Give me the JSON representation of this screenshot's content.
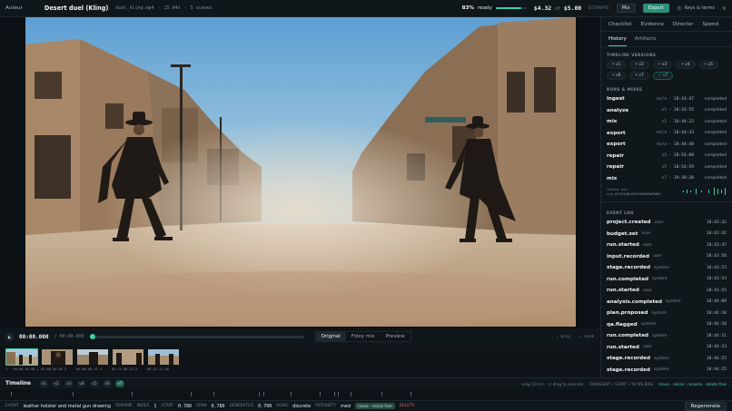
{
  "topbar": {
    "brand": "Auteur",
    "title": "Desert duel (Kling)",
    "file": "duel_kling.mp4",
    "duration": "15.04s",
    "scenes": "5 scenes",
    "ready_pct": "83%",
    "ready_label": "ready",
    "ready_fraction": 0.83,
    "spent": "$4.32",
    "of_label": "of",
    "budget": "$5.00",
    "estimate_label": "ESTIMATE",
    "mix_label": "Mix",
    "export_label": "Export",
    "help_glyph": "?",
    "keys_label": "Keys & terms",
    "close_glyph": "×"
  },
  "transport": {
    "timecode": "00:00.000",
    "duration": "/ 00:00.000",
    "progress_fraction": 0.0,
    "modes": [
      "Original",
      "Foley mix",
      "Preview"
    ],
    "active_mode": 0,
    "hint_play": "⇧ play",
    "hint_seek": "… seek"
  },
  "filmstrip": {
    "labels": [
      "1 · 00:00-02.98 2",
      "02:08-04.08 3",
      "04:08-06.23 4",
      "05.21-08.23 5",
      "08.23-11.84"
    ]
  },
  "timeline": {
    "label": "Timeline",
    "versions": [
      "v1",
      "v2",
      "v3",
      "v4",
      "v5",
      "v6",
      "v7"
    ],
    "active_version": 6,
    "snap": "snap 10 ms · ⌥ drag to override",
    "shortcuts": "TRANSIENT • START • 50 MS BIAS",
    "actions": "move · resize · rename · delete free"
  },
  "event": {
    "label_event": "EVENT",
    "event_text": "leather holster and metal gun drawing",
    "rename": "RENAME",
    "index_label": "INDEX",
    "index": "1",
    "start_label": "START",
    "start": "0.780",
    "span_label": "SPAN",
    "span": "0.780",
    "generated_label": "GENERATED",
    "generated": "0.700",
    "song_label": "SONG",
    "song": "discrete",
    "intensity_label": "INTENSITY",
    "intensity": "med",
    "tag": "move · resize free",
    "delete": "DELETE",
    "regenerate": "Regenerate"
  },
  "panel": {
    "tabs": [
      "Checklist",
      "Evidence",
      "Director",
      "Spend"
    ],
    "subtabs": [
      "History",
      "Artifacts"
    ],
    "active_subtab": 0,
    "versions_heading": "TIMELINE VERSIONS",
    "versions": [
      "v1",
      "v2",
      "v3",
      "v4",
      "v5",
      "v6",
      "v7"
    ],
    "current_version": "✓ v7",
    "runs_heading": "RUNS & MIXES",
    "runs": [
      {
        "name": "ingest",
        "ver": "en/a",
        "time": "18:43:47",
        "status": "completed"
      },
      {
        "name": "analyze",
        "ver": "v1",
        "time": "18:43:55",
        "status": "completed"
      },
      {
        "name": "mix",
        "ver": "v1",
        "time": "18:44:23",
        "status": "completed"
      },
      {
        "name": "export",
        "ver": "en/a",
        "time": "18:44:43",
        "status": "completed"
      },
      {
        "name": "export",
        "ver": "en/a",
        "time": "18:44:48",
        "status": "completed"
      },
      {
        "name": "repair",
        "ver": "v3",
        "time": "18:54:00",
        "status": "completed"
      },
      {
        "name": "repair",
        "ver": "v5",
        "time": "18:54:59",
        "status": "completed"
      },
      {
        "name": "mix",
        "ver": "v7",
        "time": "19:30:20",
        "status": "completed"
      }
    ],
    "latest_mix": "latest mix · run_01KZ4Q8J8XE5QSNNXWSWBX",
    "events_heading": "EVENT LOG",
    "events": [
      {
        "name": "project.created",
        "actor": "user",
        "time": "18:43:42"
      },
      {
        "name": "budget.set",
        "actor": "user",
        "time": "18:43:42"
      },
      {
        "name": "run.started",
        "actor": "user",
        "time": "18:43:47"
      },
      {
        "name": "input.recorded",
        "actor": "user",
        "time": "18:43:50"
      },
      {
        "name": "stage.recorded",
        "actor": "system",
        "time": "18:43:53"
      },
      {
        "name": "run.completed",
        "actor": "system",
        "time": "18:43:53"
      },
      {
        "name": "run.started",
        "actor": "user",
        "time": "18:43:55"
      },
      {
        "name": "analysis.completed",
        "actor": "system",
        "time": "18:44:09"
      },
      {
        "name": "plan.proposed",
        "actor": "system",
        "time": "18:44:10"
      },
      {
        "name": "qa.flagged",
        "actor": "system",
        "time": "18:44:10"
      },
      {
        "name": "run.completed",
        "actor": "system",
        "time": "18:44:11"
      },
      {
        "name": "run.started",
        "actor": "user",
        "time": "18:44:23"
      },
      {
        "name": "stage.recorded",
        "actor": "system",
        "time": "18:44:25"
      },
      {
        "name": "stage.recorded",
        "actor": "system",
        "time": "18:44:25"
      },
      {
        "name": "stage.recorded",
        "actor": "system",
        "time": "18:44:26"
      }
    ]
  },
  "colors": {
    "accent": "#3ecfa8",
    "export_bg": "#2c8f79",
    "delete": "#e05a5a"
  }
}
